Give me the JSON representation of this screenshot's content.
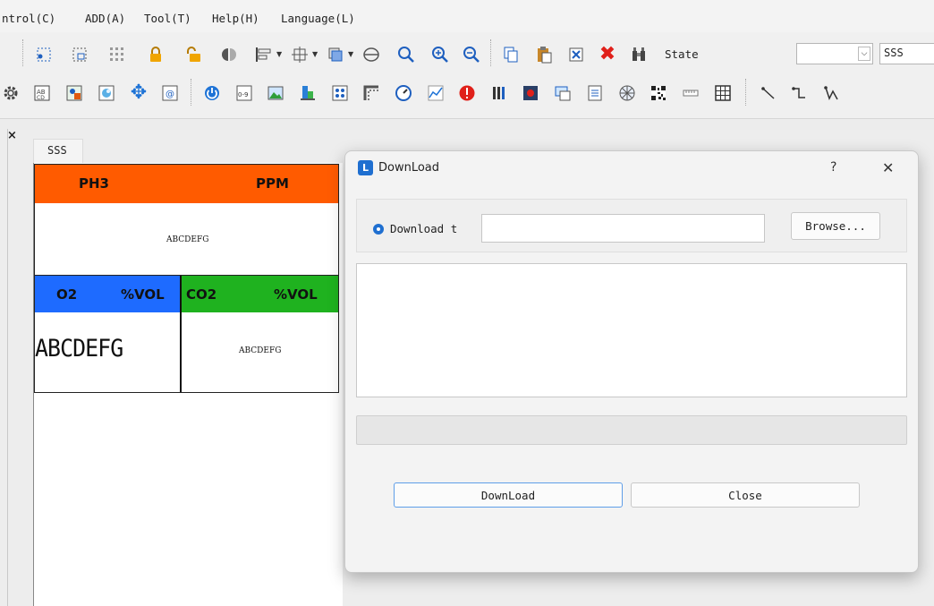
{
  "menu": {
    "items": [
      "ntrol(C)",
      "ADD(A)",
      "Tool(T)",
      "Help(H)",
      "Language(L)"
    ]
  },
  "toolbar": {
    "state_label": "State",
    "state_value": "",
    "project_value": "SSS"
  },
  "document_tab": {
    "close_glyph": "×",
    "label": "SSS"
  },
  "panel": {
    "top": {
      "left_label": "PH3",
      "right_label": "PPM",
      "value": "ABCDEFG",
      "color": "#ff5b00"
    },
    "o2": {
      "left_label": "O2",
      "right_label": "%VOL",
      "value": "ABCDEFG",
      "color": "#1e6bff"
    },
    "co2": {
      "left_label": "CO2",
      "right_label": "%VOL",
      "value": "ABCDEFG",
      "color": "#1fb21f"
    }
  },
  "dialog": {
    "title": "DownLoad",
    "help_glyph": "?",
    "close_glyph": "✕",
    "radio_label": "Download t",
    "path_value": "",
    "browse_label": "Browse...",
    "download_label": "DownLoad",
    "close_label": "Close",
    "progress_percent": 0,
    "accent": "#1f6fd0"
  },
  "icons": {
    "row1": [
      "select-icon",
      "select-area-icon",
      "grid-icon",
      "lock-icon",
      "unlock-icon",
      "mirror-icon",
      "align-left-icon",
      "center-icon",
      "layer-icon",
      "flip-icon",
      "zoom-fit-icon",
      "zoom-in-icon",
      "zoom-out-icon",
      "copy-icon",
      "paste-icon",
      "cut-icon",
      "delete-icon",
      "binoculars-icon"
    ],
    "row2": [
      "gear-icon",
      "text-icon",
      "image-button-icon",
      "picture-icon",
      "move-icon",
      "at-icon",
      "power-icon",
      "number-icon",
      "image-icon",
      "bar-stack-icon",
      "dots-icon",
      "corner-icon",
      "gauge-icon",
      "trend-icon",
      "alarm-icon",
      "bars-icon",
      "record-icon",
      "monitor-icon",
      "document-icon",
      "wheel-icon",
      "qr-icon",
      "scale-icon",
      "table-icon",
      "line-icon",
      "polyline-icon",
      "path-icon"
    ]
  }
}
